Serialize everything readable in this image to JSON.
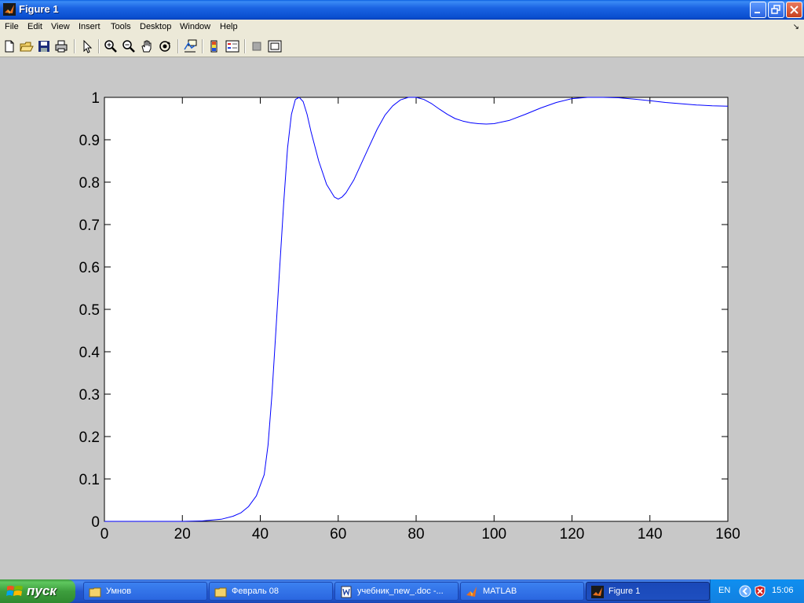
{
  "window": {
    "title": "Figure 1"
  },
  "menu": [
    "File",
    "Edit",
    "View",
    "Insert",
    "Tools",
    "Desktop",
    "Window",
    "Help"
  ],
  "menu_arrow": "↘",
  "toolbar": [
    "new-figure-icon",
    "open-file-icon",
    "save-icon",
    "print-icon",
    "edit-plot-arrow-icon",
    "zoom-in-icon",
    "zoom-out-icon",
    "pan-hand-icon",
    "rotate-3d-icon",
    "data-cursor-icon",
    "insert-colorbar-icon",
    "insert-legend-icon",
    "hide-plot-tools-icon",
    "show-plot-tools-icon"
  ],
  "chart_data": {
    "type": "line",
    "x": [
      0,
      10,
      20,
      25,
      30,
      33,
      35,
      37,
      39,
      41,
      42,
      43,
      44,
      45,
      46,
      47,
      48,
      49,
      50,
      51,
      52,
      53,
      55,
      57,
      59,
      60,
      61,
      62,
      64,
      66,
      68,
      70,
      72,
      74,
      76,
      78,
      80,
      82,
      84,
      86,
      88,
      90,
      92,
      94,
      96,
      98,
      100,
      104,
      108,
      112,
      116,
      120,
      124,
      128,
      132,
      136,
      140,
      144,
      148,
      152,
      156,
      160
    ],
    "series": [
      {
        "color": "#0000ff",
        "values": [
          0,
          0,
          0,
          0.001,
          0.005,
          0.012,
          0.02,
          0.035,
          0.06,
          0.11,
          0.18,
          0.3,
          0.45,
          0.6,
          0.75,
          0.88,
          0.96,
          0.995,
          1.0,
          0.99,
          0.96,
          0.92,
          0.85,
          0.795,
          0.765,
          0.76,
          0.765,
          0.775,
          0.805,
          0.845,
          0.885,
          0.925,
          0.958,
          0.98,
          0.994,
          1.0,
          1.0,
          0.995,
          0.985,
          0.972,
          0.96,
          0.95,
          0.944,
          0.94,
          0.938,
          0.937,
          0.938,
          0.946,
          0.96,
          0.975,
          0.988,
          0.997,
          1.0,
          1.0,
          0.999,
          0.996,
          0.992,
          0.988,
          0.985,
          0.982,
          0.98,
          0.979
        ]
      }
    ],
    "xlim": [
      0,
      160
    ],
    "ylim": [
      0,
      1
    ],
    "xticks": [
      "0",
      "20",
      "40",
      "60",
      "80",
      "100",
      "120",
      "140",
      "160"
    ],
    "yticks": [
      "0",
      "0.1",
      "0.2",
      "0.3",
      "0.4",
      "0.5",
      "0.6",
      "0.7",
      "0.8",
      "0.9",
      "1"
    ],
    "grid": false
  },
  "taskbar": {
    "start_label": "пуск",
    "tasks": [
      {
        "label": "Умнов"
      },
      {
        "label": "Февраль 08"
      },
      {
        "label": "учебник_new_.doc -..."
      },
      {
        "label": "MATLAB"
      },
      {
        "label": "Figure 1"
      }
    ],
    "lang": "EN",
    "clock": "15:06"
  }
}
